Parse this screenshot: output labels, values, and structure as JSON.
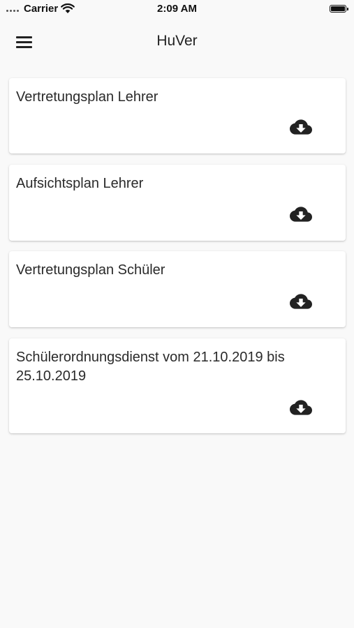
{
  "status_bar": {
    "carrier": "Carrier",
    "time": "2:09 AM"
  },
  "app_bar": {
    "title": "HuVer",
    "menu_icon": "hamburger-menu-icon"
  },
  "documents": [
    {
      "title": "Vertretungsplan Lehrer",
      "action_icon": "cloud-download-icon"
    },
    {
      "title": "Aufsichtsplan Lehrer",
      "action_icon": "cloud-download-icon"
    },
    {
      "title": "Vertretungsplan Schüler",
      "action_icon": "cloud-download-icon"
    },
    {
      "title": "Schülerordnungsdienst vom 21.10.2019 bis 25.10.2019",
      "action_icon": "cloud-download-icon"
    }
  ],
  "colors": {
    "background": "#f9f9f9",
    "card": "#ffffff",
    "text": "#222222",
    "icon": "#222222"
  }
}
